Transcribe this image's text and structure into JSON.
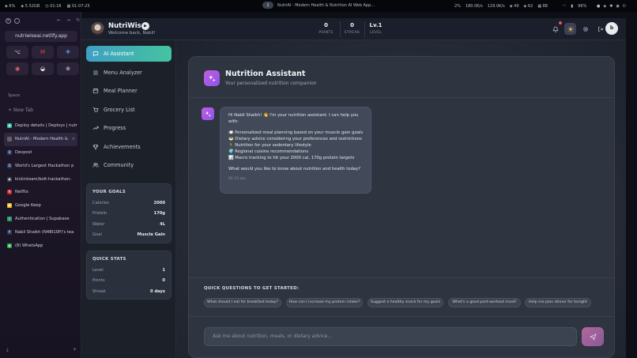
{
  "system_bar": {
    "left": [
      "◈ 6%",
      "◈ 5.52GB",
      "◷ 01:16",
      "▦ 01-07-25"
    ],
    "workspace": "1",
    "window_title": "NutriAI - Modern Health & Nutrition AI Web App...",
    "stats": [
      "2%",
      "180.0K/s",
      "129.0K/s",
      "◈ 49",
      "◈ 62",
      "▦ 88"
    ],
    "battery": "96%"
  },
  "browser": {
    "url": "nutriwiseai.netlify.app",
    "favorites": [
      "⌥",
      "M",
      "✚",
      "◉",
      "◒",
      "⊚"
    ],
    "space_label": "Space",
    "new_tab": "+ New Tab",
    "tabs": [
      {
        "label": "Deploy details | Deploys | nutr",
        "icon_color": "#2fb5a8",
        "icon": "◆",
        "active": false
      },
      {
        "label": "NutriAI - Modern Health & ",
        "icon_color": "#6f5b5b",
        "icon": "",
        "active": true
      },
      {
        "label": "Devpost",
        "icon_color": "#2a3a66",
        "icon": "D",
        "active": false
      },
      {
        "label": "World's Largest Hackathon p",
        "icon_color": "#2a3a66",
        "icon": "D",
        "active": false
      },
      {
        "label": "kickinteam/bolt-hackathon-",
        "icon_color": "#3a3f4a",
        "icon": "◉",
        "active": false
      },
      {
        "label": "Netflix",
        "icon_color": "#c8232c",
        "icon": "N",
        "active": false
      },
      {
        "label": "Google Keep",
        "icon_color": "#e7b416",
        "icon": "▣",
        "active": false
      },
      {
        "label": "Authentication | Supabase",
        "icon_color": "#2d9c63",
        "icon": "⚡",
        "active": false
      },
      {
        "label": "Nabil Shaikh (N4BI10P)'s tea",
        "icon_color": "#2a3a66",
        "icon": "P",
        "active": false
      },
      {
        "label": "(8) WhatsApp",
        "icon_color": "#25a244",
        "icon": "◉",
        "active": false
      }
    ]
  },
  "header": {
    "brand": "NutriWise",
    "welcome": "Welcome back, Nabil!",
    "stats": [
      {
        "value": "0",
        "label": "POINTS"
      },
      {
        "value": "0",
        "label": "STREAK"
      },
      {
        "value": "Lv.1",
        "label": "LEVEL"
      }
    ],
    "user_initial": "b",
    "icons": [
      "bell-icon",
      "sun-icon",
      "gear-icon",
      "logout-icon"
    ]
  },
  "nav": [
    {
      "label": "AI Assistant",
      "icon": "chat-icon",
      "active": true
    },
    {
      "label": "Menu Analyzer",
      "icon": "menu-icon",
      "active": false
    },
    {
      "label": "Meal Planner",
      "icon": "calendar-icon",
      "active": false
    },
    {
      "label": "Grocery List",
      "icon": "cart-icon",
      "active": false
    },
    {
      "label": "Progress",
      "icon": "trend-icon",
      "active": false
    },
    {
      "label": "Achievements",
      "icon": "trophy-icon",
      "active": false
    },
    {
      "label": "Community",
      "icon": "users-icon",
      "active": false
    }
  ],
  "goals": {
    "title": "YOUR GOALS",
    "rows": [
      {
        "label": "Calories",
        "value": "2000"
      },
      {
        "label": "Protein",
        "value": "170g"
      },
      {
        "label": "Water",
        "value": "4L"
      },
      {
        "label": "Goal",
        "value": "Muscle Gain"
      }
    ]
  },
  "quick_stats": {
    "title": "QUICK STATS",
    "rows": [
      {
        "label": "Level",
        "value": "1"
      },
      {
        "label": "Points",
        "value": "0"
      },
      {
        "label": "Streak",
        "value": "0 days"
      }
    ]
  },
  "assistant": {
    "title": "Nutrition Assistant",
    "subtitle": "Your personalized nutrition companion",
    "message": {
      "intro": [
        "Hi Nabil Shaikh! 👋 I'm your nutrition assistant. I can help you",
        "with:"
      ],
      "bullets": [
        "🍽️ Personalized meal planning based on your muscle gain goals",
        "🥗 Dietary advice considering your preferences and restrictions",
        "🏃 Nutrition for your sedentary lifestyle",
        "🌍 Regional cuisine recommendations",
        "📊 Macro tracking to hit your 2000 cal, 170g protein targets"
      ],
      "closing": "What would you like to know about nutrition and health today?",
      "time": "01:15 am"
    },
    "quick_title": "QUICK QUESTIONS TO GET STARTED:",
    "quick_questions": [
      "What should I eat for breakfast today?",
      "How can I increase my protein intake?",
      "Suggest a healthy snack for my goals",
      "What's a good post-workout meal?",
      "Help me plan dinner for tonight"
    ],
    "input_placeholder": "Ask me about nutrition, meals, or dietary advice..."
  }
}
